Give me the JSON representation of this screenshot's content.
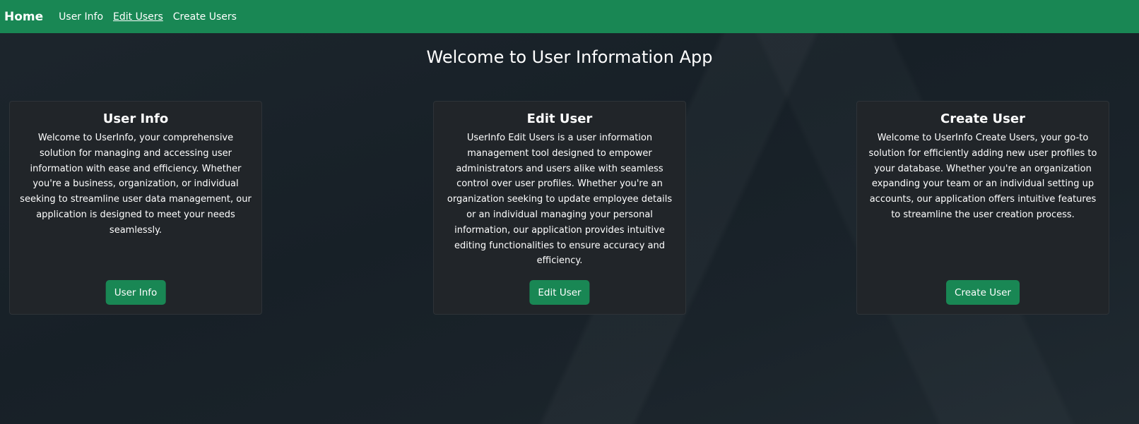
{
  "navbar": {
    "brand": "Home",
    "links": [
      {
        "label": "User Info"
      },
      {
        "label": "Edit Users"
      },
      {
        "label": "Create Users"
      }
    ],
    "active_index": 1,
    "color": "#198754"
  },
  "main": {
    "title": "Welcome to User Information App"
  },
  "cards": [
    {
      "title": "User Info",
      "text": "Welcome to UserInfo, your comprehensive solution for managing and accessing user information with ease and efficiency. Whether you're a business, organization, or individual seeking to streamline user data management, our application is designed to meet your needs seamlessly.",
      "button": "User Info"
    },
    {
      "title": "Edit User",
      "text": "UserInfo Edit Users is a user information management tool designed to empower administrators and users alike with seamless control over user profiles. Whether you're an organization seeking to update employee details or an individual managing your personal information, our application provides intuitive editing functionalities to ensure accuracy and efficiency.",
      "button": "Edit User"
    },
    {
      "title": "Create User",
      "text": "Welcome to UserInfo Create Users, your go-to solution for efficiently adding new user profiles to your database. Whether you're an organization expanding your team or an individual setting up accounts, our application offers intuitive features to streamline the user creation process.",
      "button": "Create User"
    }
  ],
  "colors": {
    "accent": "#198754",
    "card_bg": "#212529",
    "page_bg": "#1b232a"
  }
}
